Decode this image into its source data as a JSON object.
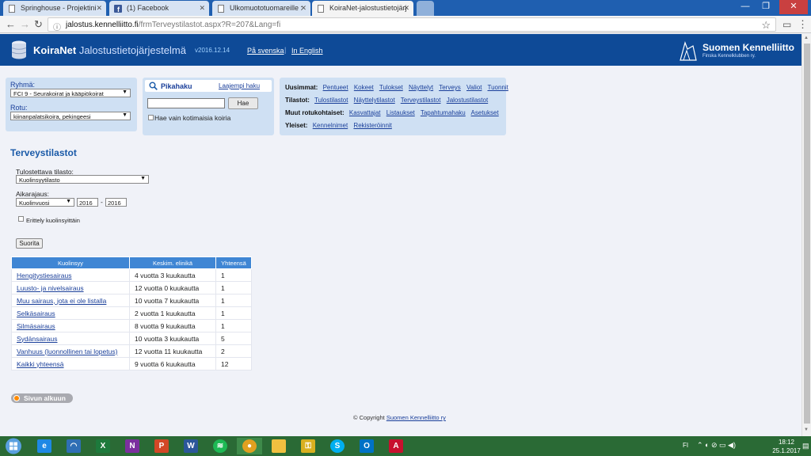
{
  "browser": {
    "tabs": [
      {
        "title": "Springhouse - Projektini"
      },
      {
        "title": "(1) Facebook"
      },
      {
        "title": "Ulkomuototuomareille :"
      },
      {
        "title": "KoiraNet-jalostustietojärj"
      }
    ],
    "url_domain": "jalostus.kennelliitto.fi",
    "url_path": "/frmTerveystilastot.aspx?R=207&Lang=fi"
  },
  "header": {
    "brand_a": "KoiraNet",
    "brand_b": "Jalostustietojärjestelmä",
    "version": "v2016.12.14",
    "lang_sv": "På svenska",
    "lang_en": "In English",
    "separator": "|",
    "org_name": "Suomen Kennelliitto",
    "org_sub": "Finska Kennelklubben ry."
  },
  "group_panel": {
    "ryhma_label": "Ryhmä:",
    "ryhma_value": "FCI 9 - Seurakoirat ja kääpiökoirat",
    "rotu_label": "Rotu:",
    "rotu_value": "kiinanpalatsikoira, pekingeesi"
  },
  "quick_search": {
    "title": "Pikahaku",
    "advanced": "Laajempi haku",
    "input_value": "",
    "button": "Hae",
    "checkbox_label": "Hae vain kotimaisia koiria"
  },
  "links_panel": {
    "rows": [
      {
        "label": "Uusimmat:",
        "links": [
          "Pentueet",
          "Kokeet",
          "Tulokset",
          "Näyttelyt",
          "Terveys",
          "Valiot",
          "Tuonnit"
        ]
      },
      {
        "label": "Tilastot:",
        "links": [
          "Tulostilastot",
          "Näyttelytilastot",
          "Terveystilastot",
          "Jalostustilastot"
        ]
      },
      {
        "label": "Muut rotukohtaiset:",
        "links": [
          "Kasvattajat",
          "Listaukset",
          "Tapahtumahaku",
          "Asetukset"
        ]
      },
      {
        "label": "Yleiset:",
        "links": [
          "Kennelnimet",
          "Rekisteröinnit"
        ]
      }
    ]
  },
  "content": {
    "title": "Terveystilastot",
    "stat_label": "Tulostettava tilasto:",
    "stat_value": "Kuolinsyytilasto",
    "period_label": "Aikarajaus:",
    "period_type": "Kuolinvuosi",
    "year_from": "2016",
    "year_dash": "-",
    "year_to": "2016",
    "per_year_label": "Erittely kuolinsyittäin",
    "submit": "Suorita"
  },
  "table": {
    "headers": [
      "Kuolinsyy",
      "Keskim. elinikä",
      "Yhteensä"
    ],
    "rows": [
      {
        "cause": "Hengitystiesairaus",
        "age": "4 vuotta 3 kuukautta",
        "total": "1"
      },
      {
        "cause": "Luusto- ja nivelsairaus",
        "age": "12 vuotta 0 kuukautta",
        "total": "1"
      },
      {
        "cause": "Muu sairaus, jota ei ole listalla",
        "age": "10 vuotta 7 kuukautta",
        "total": "1"
      },
      {
        "cause": "Selkäsairaus",
        "age": "2 vuotta 1 kuukautta",
        "total": "1"
      },
      {
        "cause": "Silmäsairaus",
        "age": "8 vuotta 9 kuukautta",
        "total": "1"
      },
      {
        "cause": "Sydänsairaus",
        "age": "10 vuotta 3 kuukautta",
        "total": "5"
      },
      {
        "cause": "Vanhuus (luonnollinen tai lopetus)",
        "age": "12 vuotta 11 kuukautta",
        "total": "2"
      },
      {
        "cause": "Kaikki yhteensä",
        "age": "9 vuotta 6 kuukautta",
        "total": "12"
      }
    ]
  },
  "footer": {
    "to_top": "Sivun alkuun",
    "copyright_prefix": "© Copyright",
    "copyright_link": "Suomen Kennelliitto ry"
  },
  "taskbar": {
    "lang": "FI",
    "time": "18:12",
    "date": "25.1.2017"
  }
}
